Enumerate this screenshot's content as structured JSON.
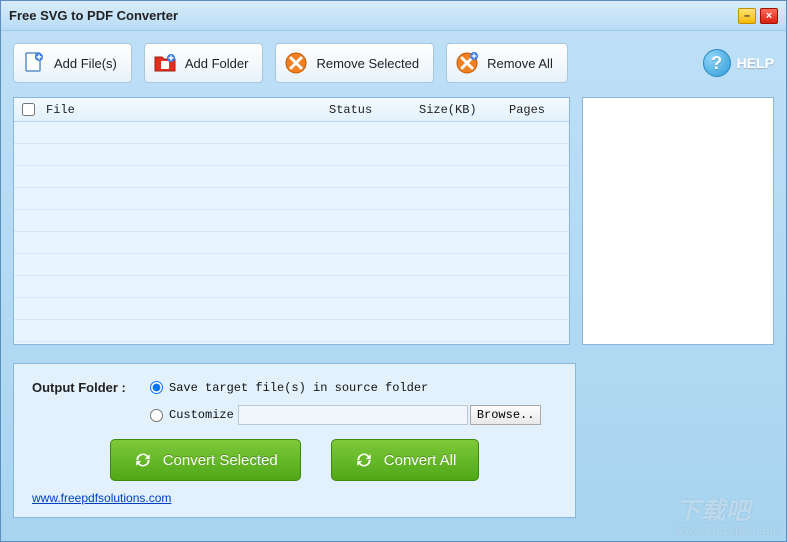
{
  "window": {
    "title": "Free SVG to PDF Converter"
  },
  "toolbar": {
    "add_files": "Add File(s)",
    "add_folder": "Add Folder",
    "remove_selected": "Remove Selected",
    "remove_all": "Remove All",
    "help": "HELP"
  },
  "table": {
    "headers": {
      "file": "File",
      "status": "Status",
      "size": "Size(KB)",
      "pages": "Pages"
    },
    "rows": []
  },
  "options": {
    "label": "Output Folder :",
    "save_source": "Save target file(s) in source folder",
    "customize": "Customize",
    "customize_value": "",
    "browse": "Browse..",
    "convert_selected": "Convert Selected",
    "convert_all": "Convert All"
  },
  "footer": {
    "link": "www.freepdfsolutions.com"
  },
  "watermark": {
    "big": "下载吧",
    "small": "www.xiazaiba.com"
  }
}
